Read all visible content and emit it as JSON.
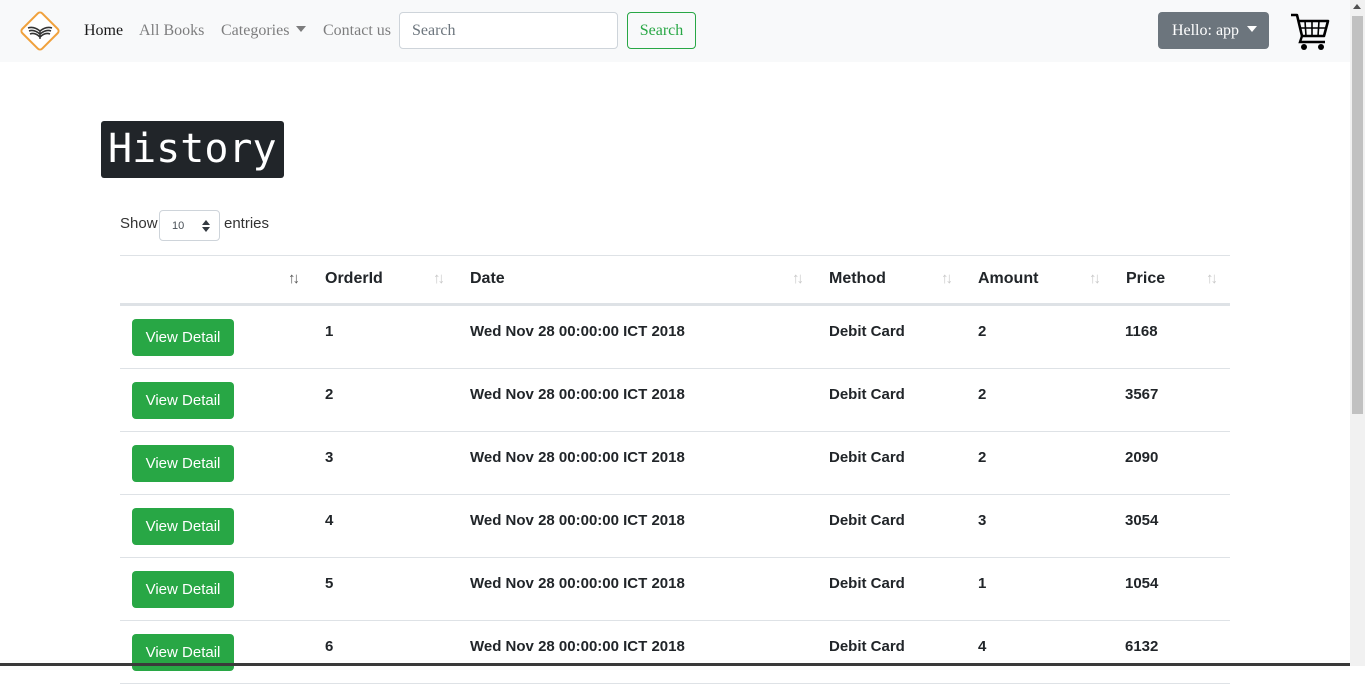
{
  "navbar": {
    "links": {
      "home": "Home",
      "all_books": "All Books",
      "categories": "Categories",
      "contact": "Contact us"
    },
    "search": {
      "placeholder": "Search",
      "button": "Search"
    },
    "user_menu": "Hello: app"
  },
  "page": {
    "title": "History",
    "length": {
      "show": "Show",
      "value": "10",
      "entries": "entries"
    }
  },
  "table": {
    "headers": [
      "",
      "OrderId",
      "Date",
      "Method",
      "Amount",
      "Price"
    ],
    "action_label": "View Detail",
    "rows": [
      {
        "order_id": "1",
        "date": "Wed Nov 28 00:00:00 ICT 2018",
        "method": "Debit Card",
        "amount": "2",
        "price": "1168"
      },
      {
        "order_id": "2",
        "date": "Wed Nov 28 00:00:00 ICT 2018",
        "method": "Debit Card",
        "amount": "2",
        "price": "3567"
      },
      {
        "order_id": "3",
        "date": "Wed Nov 28 00:00:00 ICT 2018",
        "method": "Debit Card",
        "amount": "2",
        "price": "2090"
      },
      {
        "order_id": "4",
        "date": "Wed Nov 28 00:00:00 ICT 2018",
        "method": "Debit Card",
        "amount": "3",
        "price": "3054"
      },
      {
        "order_id": "5",
        "date": "Wed Nov 28 00:00:00 ICT 2018",
        "method": "Debit Card",
        "amount": "1",
        "price": "1054"
      },
      {
        "order_id": "6",
        "date": "Wed Nov 28 00:00:00 ICT 2018",
        "method": "Debit Card",
        "amount": "4",
        "price": "6132"
      }
    ]
  },
  "colors": {
    "success": "#28a745",
    "secondary": "#6c757d",
    "navbar_bg": "#f8f9fa",
    "title_bg": "#212529",
    "logo_accent": "#f0a13c"
  },
  "icons": [
    "book-logo-icon",
    "caret-down-icon",
    "cart-icon",
    "sort-icon",
    "select-arrows-icon"
  ]
}
